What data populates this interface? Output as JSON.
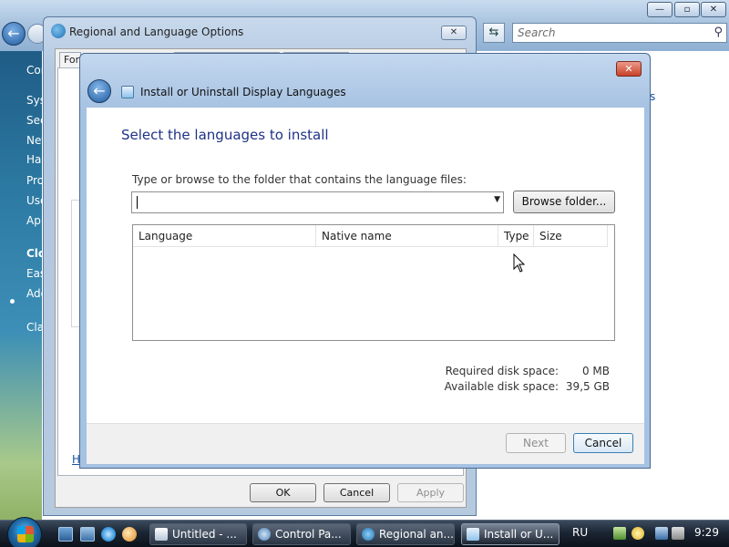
{
  "control_panel": {
    "search_placeholder": "Search",
    "sidebar_items": [
      "Control Panel Home",
      "System and Maintenance",
      "Security",
      "Network and Internet",
      "Hardware and Sound",
      "Programs",
      "User Accounts",
      "Appearance and Personalization",
      "Clock, Language, and Region",
      "Ease of Access",
      "Additional Options",
      "Classic View"
    ],
    "right_fragment": "s",
    "window_buttons": {
      "minimize": "—",
      "maximize": "▫",
      "close": "✕"
    }
  },
  "regional_dialog": {
    "title": "Regional and Language Options",
    "tab_fragment": "Formats",
    "help_link_fragment": "H",
    "buttons": {
      "ok": "OK",
      "cancel": "Cancel",
      "apply": "Apply"
    }
  },
  "wizard": {
    "window_title": "Install or Uninstall Display Languages",
    "heading": "Select the languages to install",
    "folder_prompt": "Type or browse to the folder that contains the language files:",
    "folder_value": "",
    "browse_button": "Browse folder...",
    "columns": [
      "Language",
      "Native name",
      "Type",
      "Size"
    ],
    "rows": [],
    "required_label": "Required disk space:",
    "required_value": "0 MB",
    "available_label": "Available disk space:",
    "available_value": "39,5 GB",
    "next_button": "Next",
    "cancel_button": "Cancel"
  },
  "taskbar": {
    "tasks": [
      "Untitled - ...",
      "Control Pa...",
      "Regional an...",
      "Install or U..."
    ],
    "language": "RU",
    "clock": "9:29"
  }
}
